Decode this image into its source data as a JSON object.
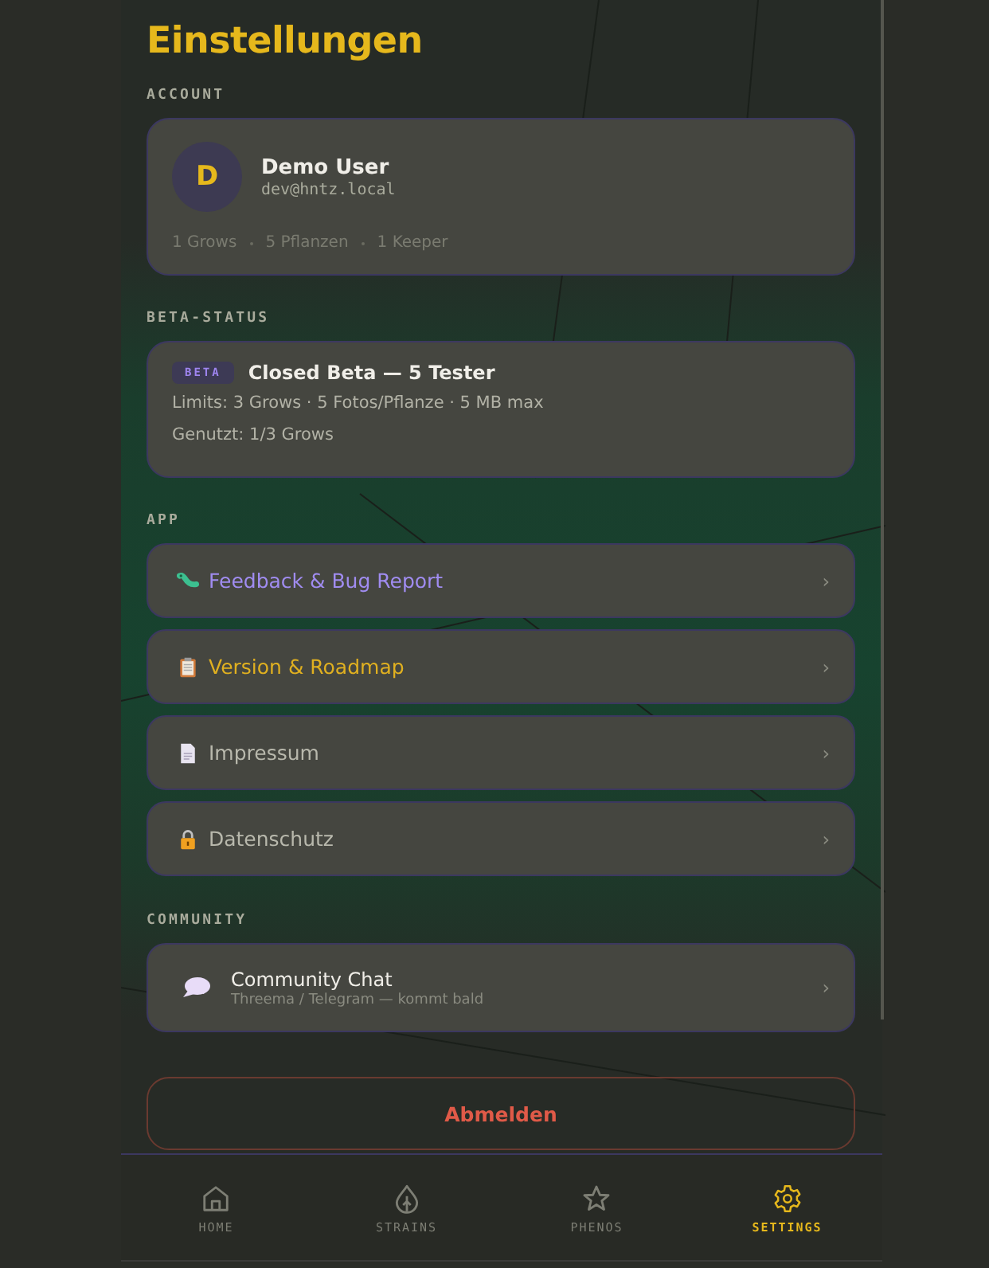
{
  "title": "Einstellungen",
  "account": {
    "section": "ACCOUNT",
    "initial": "D",
    "name": "Demo User",
    "email": "dev@hntz.local",
    "stats": [
      "1 Grows",
      "5 Pflanzen",
      "1 Keeper"
    ]
  },
  "beta": {
    "section": "BETA-STATUS",
    "badge": "BETA",
    "title": "Closed Beta — 5 Tester",
    "lines": [
      "Limits: 3 Grows · 5 Fotos/Pflanze · 5 MB max",
      "Genutzt: 1/3 Grows"
    ]
  },
  "app": {
    "section": "APP",
    "items": [
      {
        "label": "Feedback & Bug Report",
        "color": "#a08cf0",
        "chevron": "›"
      },
      {
        "label": "Version & Roadmap",
        "color": "#e0b020",
        "chevron": "›"
      },
      {
        "label": "Impressum",
        "color": "#b8b8ac",
        "chevron": "›"
      },
      {
        "label": "Datenschutz",
        "color": "#b8b8ac",
        "chevron": "›"
      }
    ]
  },
  "community": {
    "section": "COMMUNITY",
    "title": "Community Chat",
    "subtitle": "Threema / Telegram — kommt bald",
    "chevron": "›"
  },
  "logout": "Abmelden",
  "nav": [
    {
      "label": "HOME",
      "selected": false
    },
    {
      "label": "STRAINS",
      "selected": false
    },
    {
      "label": "PHENOS",
      "selected": false
    },
    {
      "label": "SETTINGS",
      "selected": true
    }
  ]
}
